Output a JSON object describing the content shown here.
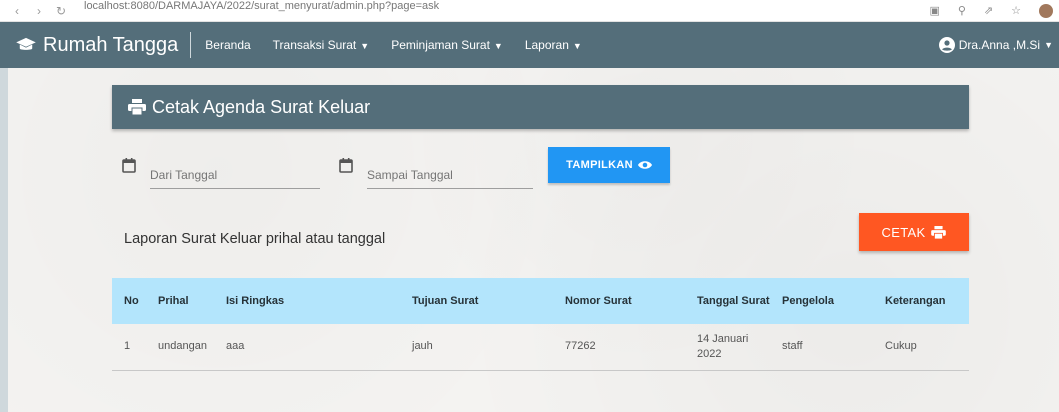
{
  "browser": {
    "url": "localhost:8080/DARMAJAYA/2022/surat_menyurat/admin.php?page=ask"
  },
  "navbar": {
    "brand": "Rumah Tangga",
    "menu": [
      {
        "label": "Beranda",
        "caret": false
      },
      {
        "label": "Transaksi Surat",
        "caret": true
      },
      {
        "label": "Peminjaman Surat",
        "caret": true
      },
      {
        "label": "Laporan",
        "caret": true
      }
    ],
    "user": "Dra.Anna ,M.Si"
  },
  "header": {
    "title": "Cetak Agenda Surat Keluar"
  },
  "filters": {
    "dari_placeholder": "Dari Tanggal",
    "sampai_placeholder": "Sampai Tanggal",
    "tampilkan_label": "TAMPILKAN"
  },
  "report": {
    "label": "Laporan Surat Keluar prihal atau tanggal",
    "cetak_label": "CETAK"
  },
  "table": {
    "columns": [
      "No",
      "Prihal",
      "Isi Ringkas",
      "Tujuan Surat",
      "Nomor Surat",
      "Tanggal Surat",
      "Pengelola",
      "Keterangan"
    ],
    "rows": [
      [
        "1",
        "undangan",
        "aaa",
        "jauh",
        "77262",
        "14 Januari 2022",
        "staff",
        "Cukup"
      ]
    ]
  },
  "colors": {
    "navbar": "#546e7a",
    "tampilkan_button": "#2196f3",
    "cetak_button": "#ff5722",
    "table_header": "#b3e5fc"
  }
}
